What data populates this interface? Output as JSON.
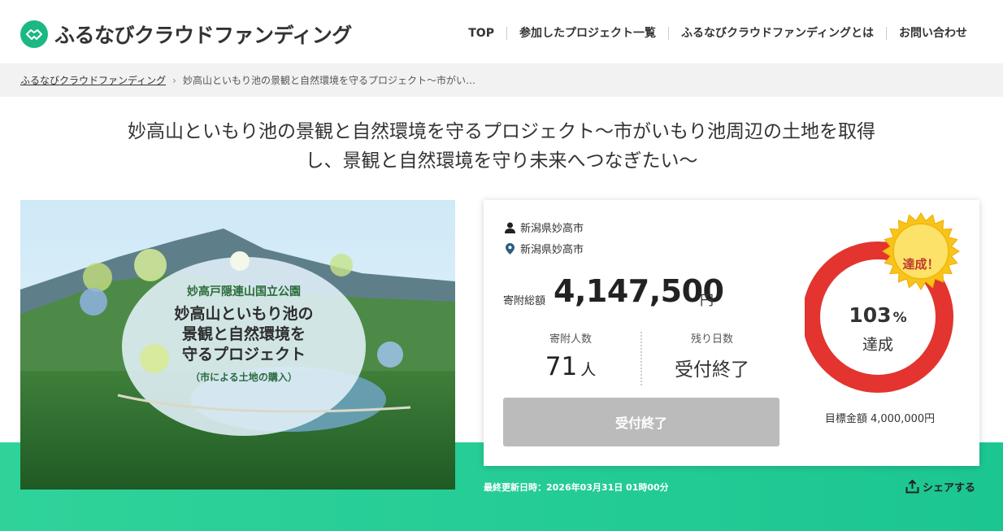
{
  "header": {
    "logo_text": "ふるなびクラウドファンディング",
    "nav": [
      {
        "label": "TOP"
      },
      {
        "label": "参加したプロジェクト一覧"
      },
      {
        "label": "ふるなびクラウドファンディングとは"
      },
      {
        "label": "お問い合わせ"
      }
    ]
  },
  "breadcrumb": {
    "home": "ふるなびクラウドファンディング",
    "current": "妙高山といもり池の景観と自然環境を守るプロジェクト～市がい…"
  },
  "project": {
    "title_line1": "妙高山といもり池の景観と自然環境を守るプロジェクト～市がいもり池周辺の土地を取得",
    "title_line2": "し、景観と自然環境を守り未来へつなぎたい～",
    "hero": {
      "park_name": "妙高戸隠連山国立公園",
      "line1": "妙高山といもり池の",
      "line2": "景観と自然環境を",
      "line3": "守るプロジェクト",
      "sub": "（市による土地の購入）"
    }
  },
  "card": {
    "organizer": "新潟県妙高市",
    "location": "新潟県妙高市",
    "amount_label": "寄附総額",
    "amount_value": "4,147,500",
    "amount_unit": "円",
    "donors_label": "寄附人数",
    "donors_value": "71",
    "donors_unit": "人",
    "days_label": "残り日数",
    "days_value": "受付終了",
    "button_label": "受付終了",
    "percent": "103",
    "percent_unit": "%",
    "percent_label": "達成",
    "badge": "達成！",
    "goal_text": "目標金額 4,000,000円",
    "achievement_fraction": 1.03
  },
  "footer": {
    "updated": "最終更新日時：2026年03月31日 01時00分",
    "share": "シェアする"
  },
  "colors": {
    "brand": "#1cb883",
    "ring": "#e3342f",
    "badge": "#f7c51a",
    "band": "#22cc93"
  }
}
